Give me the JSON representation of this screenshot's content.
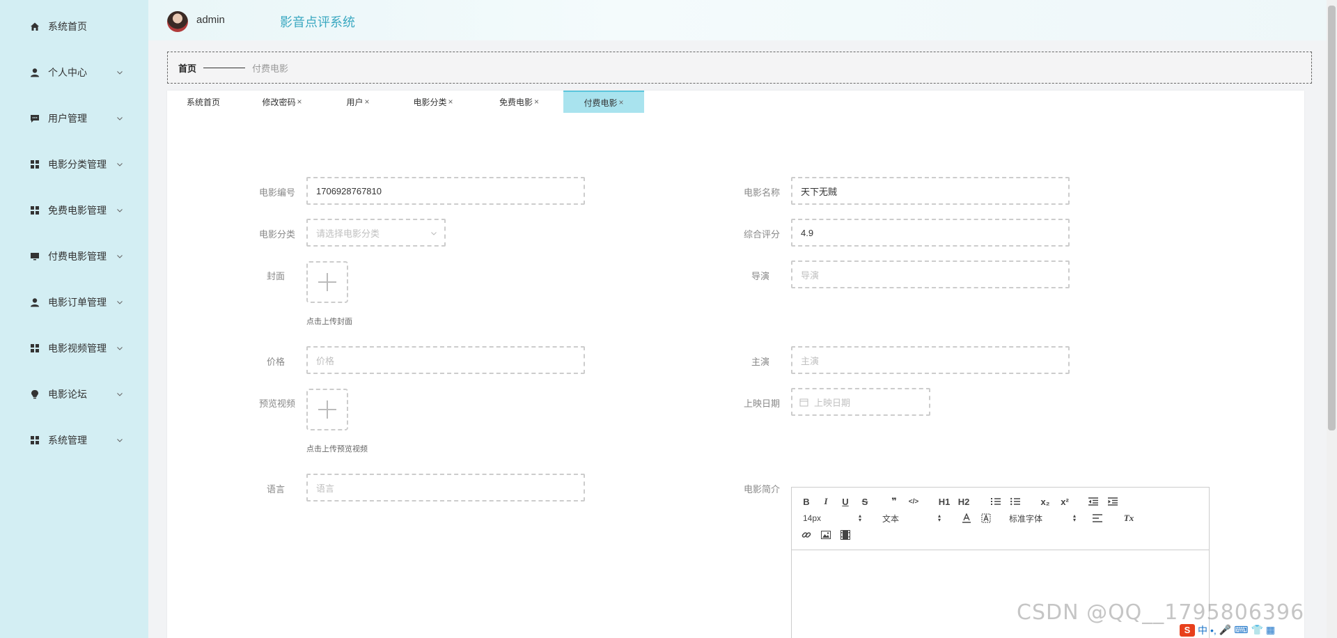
{
  "sidebar": {
    "items": [
      {
        "label": "系统首页",
        "icon": "home-icon"
      },
      {
        "label": "个人中心",
        "icon": "user-icon"
      },
      {
        "label": "用户管理",
        "icon": "chat-icon"
      },
      {
        "label": "电影分类管理",
        "icon": "grid-icon"
      },
      {
        "label": "免费电影管理",
        "icon": "grid-icon"
      },
      {
        "label": "付费电影管理",
        "icon": "monitor-icon"
      },
      {
        "label": "电影订单管理",
        "icon": "user-icon"
      },
      {
        "label": "电影视频管理",
        "icon": "grid-icon"
      },
      {
        "label": "电影论坛",
        "icon": "bulb-icon"
      },
      {
        "label": "系统管理",
        "icon": "grid-icon"
      }
    ]
  },
  "header": {
    "username": "admin",
    "title": "影音点评系统"
  },
  "breadcrumb": {
    "home": "首页",
    "current": "付费电影"
  },
  "tabs": [
    {
      "label": "系统首页",
      "closable": false,
      "active": false
    },
    {
      "label": "修改密码",
      "closable": true,
      "active": false
    },
    {
      "label": "用户",
      "closable": true,
      "active": false
    },
    {
      "label": "电影分类",
      "closable": true,
      "active": false
    },
    {
      "label": "免费电影",
      "closable": true,
      "active": false
    },
    {
      "label": "付费电影",
      "closable": true,
      "active": true
    }
  ],
  "tab_close": "×",
  "form": {
    "movie_no": {
      "label": "电影编号",
      "value": "1706928767810"
    },
    "movie_name": {
      "label": "电影名称",
      "value": "天下无贼"
    },
    "category": {
      "label": "电影分类",
      "placeholder": "请选择电影分类"
    },
    "rating": {
      "label": "综合评分",
      "value": "4.9"
    },
    "cover": {
      "label": "封面",
      "hint": "点击上传封面"
    },
    "director": {
      "label": "导演",
      "placeholder": "导演"
    },
    "price": {
      "label": "价格",
      "placeholder": "价格"
    },
    "actors": {
      "label": "主演",
      "placeholder": "主演"
    },
    "preview": {
      "label": "预览视频",
      "hint": "点击上传预览视频"
    },
    "release_date": {
      "label": "上映日期",
      "placeholder": "上映日期"
    },
    "language": {
      "label": "语言",
      "placeholder": "语言"
    },
    "intro": {
      "label": "电影简介"
    }
  },
  "editor": {
    "font_size": "14px",
    "block": "文本",
    "font": "标准字体",
    "buttons": {
      "bold": "B",
      "italic": "I",
      "underline": "U",
      "strike": "S",
      "quote": "❞",
      "code": "</>",
      "h1": "H1",
      "h2": "H2",
      "sub": "x₂",
      "sup": "x²",
      "clean": "Tx"
    }
  },
  "watermark": "CSDN @QQ__1795806396",
  "tray": {
    "logo": "S",
    "ime": "中"
  }
}
